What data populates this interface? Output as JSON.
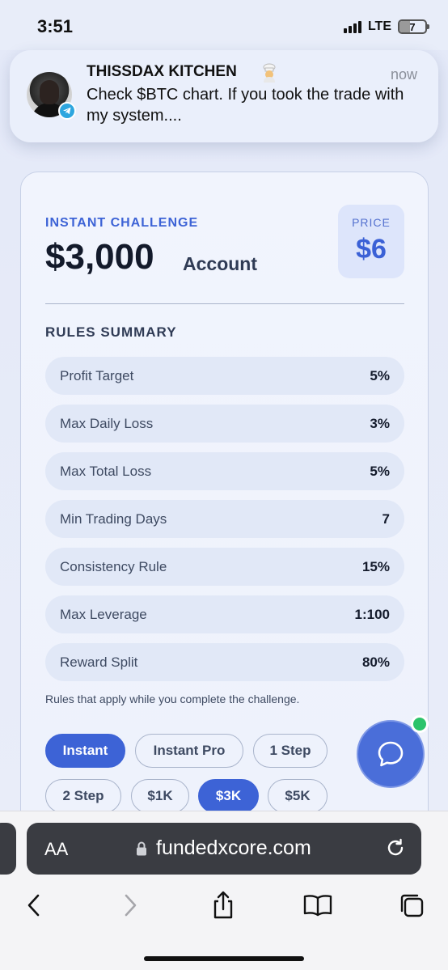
{
  "status_bar": {
    "time": "3:51",
    "network": "LTE",
    "battery": "7"
  },
  "notification": {
    "title": "THISSDAX KITCHEN",
    "time": "now",
    "body": "Check $BTC chart. If you took the trade with my system....",
    "app_icon": "telegram-icon",
    "emoji": "cook-emoji"
  },
  "challenge": {
    "label": "INSTANT CHALLENGE",
    "amount": "$3,000",
    "account_word": "Account",
    "price_label": "PRICE",
    "price_value": "$6"
  },
  "rules": {
    "title": "RULES SUMMARY",
    "items": [
      {
        "label": "Profit Target",
        "value": "5%"
      },
      {
        "label": "Max Daily Loss",
        "value": "3%"
      },
      {
        "label": "Max Total Loss",
        "value": "5%"
      },
      {
        "label": "Min Trading Days",
        "value": "7"
      },
      {
        "label": "Consistency Rule",
        "value": "15%"
      },
      {
        "label": "Max Leverage",
        "value": "1:100"
      },
      {
        "label": "Reward Split",
        "value": "80%"
      }
    ],
    "note": "Rules that apply while you complete the challenge."
  },
  "options": {
    "types": [
      "Instant",
      "Instant Pro",
      "1 Step",
      "2 Step"
    ],
    "sizes": [
      "$1K",
      "$3K",
      "$5K"
    ],
    "selected_type": "Instant",
    "selected_size": "$3K"
  },
  "colors": {
    "accent": "#3d63d6",
    "online": "#2cc36b"
  },
  "browser": {
    "aa_label": "AA",
    "url": "fundedxcore.com"
  }
}
